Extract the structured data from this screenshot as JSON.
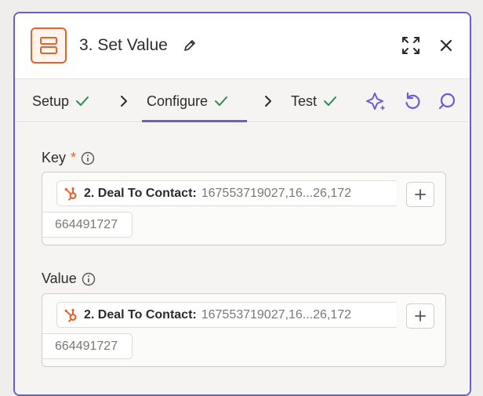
{
  "header": {
    "title": "3. Set Value",
    "app_icon": "server-icon",
    "edit_icon": "pencil-icon",
    "expand_icon": "expand-icon",
    "close_icon": "close-icon"
  },
  "tabs": [
    {
      "label": "Setup",
      "done": true
    },
    {
      "label": "Configure",
      "done": true,
      "active": true
    },
    {
      "label": "Test",
      "done": true
    }
  ],
  "toolbar_icons": [
    "sparkle-icon",
    "undo-icon",
    "comment-icon"
  ],
  "fields": [
    {
      "label": "Key",
      "required": true,
      "pill_label": "2. Deal To Contact:",
      "pill_value": "167553719027,16...26,172",
      "pill_value_cont": "664491727"
    },
    {
      "label": "Value",
      "required": false,
      "pill_label": "2. Deal To Contact:",
      "pill_value": "167553719027,16...26,172",
      "pill_value_cont": "664491727"
    }
  ],
  "colors": {
    "accent": "#6a5bd6",
    "brand_orange": "#e8622c",
    "check_green": "#2e8b57"
  }
}
